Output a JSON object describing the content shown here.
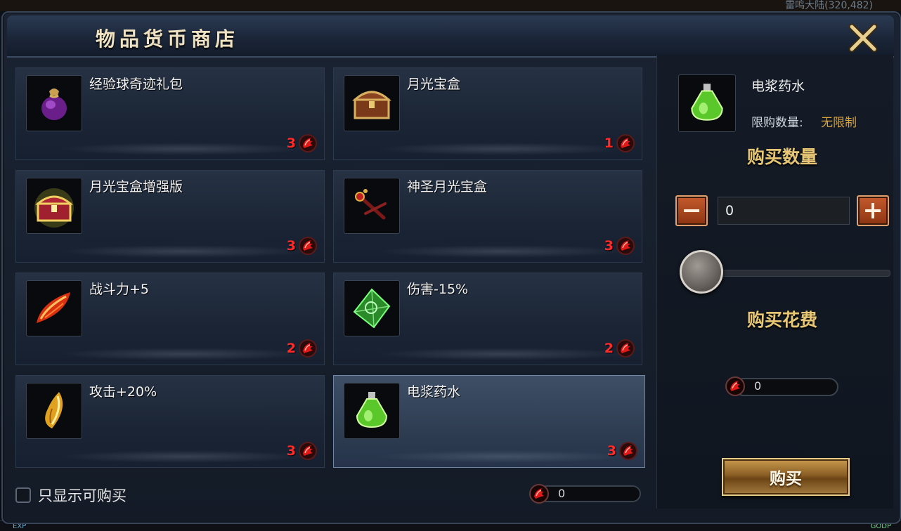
{
  "background": {
    "location_text": "雷鸣大陆(320,482)",
    "exp_label": "EXP",
    "gold_label": "GODP"
  },
  "window": {
    "title": "物品货币商店"
  },
  "items": [
    {
      "name": "经验球奇迹礼包",
      "price": "3",
      "icon": "purple-pouch-icon"
    },
    {
      "name": "月光宝盒",
      "price": "1",
      "icon": "treasure-chest-icon"
    },
    {
      "name": "月光宝盒增强版",
      "price": "3",
      "icon": "golden-chest-icon"
    },
    {
      "name": "神圣月光宝盒",
      "price": "3",
      "icon": "scepter-icon"
    },
    {
      "name": "战斗力+5",
      "price": "2",
      "icon": "red-feather-icon"
    },
    {
      "name": "伤害-15%",
      "price": "2",
      "icon": "green-gem-icon"
    },
    {
      "name": "攻击+20%",
      "price": "3",
      "icon": "gold-shard-icon"
    },
    {
      "name": "电浆药水",
      "price": "3",
      "icon": "green-potion-icon",
      "selected": true
    }
  ],
  "filter": {
    "label": "只显示可购买",
    "checked": false
  },
  "wallet": {
    "amount": "0",
    "currency_icon": "red-crest-coin-icon"
  },
  "detail": {
    "name": "电浆药水",
    "limit_label": "限购数量:",
    "limit_value": "无限制",
    "quantity_title": "购买数量",
    "quantity_value": "0",
    "slider_fraction": 0,
    "cost_title": "购买花费",
    "cost_value": "0",
    "buy_label": "购买"
  },
  "colors": {
    "price_red": "#ff2a2a",
    "gold_title": "#e7c776",
    "limit_gold": "#d9a33a",
    "accent_orange": "#c55a2c"
  }
}
